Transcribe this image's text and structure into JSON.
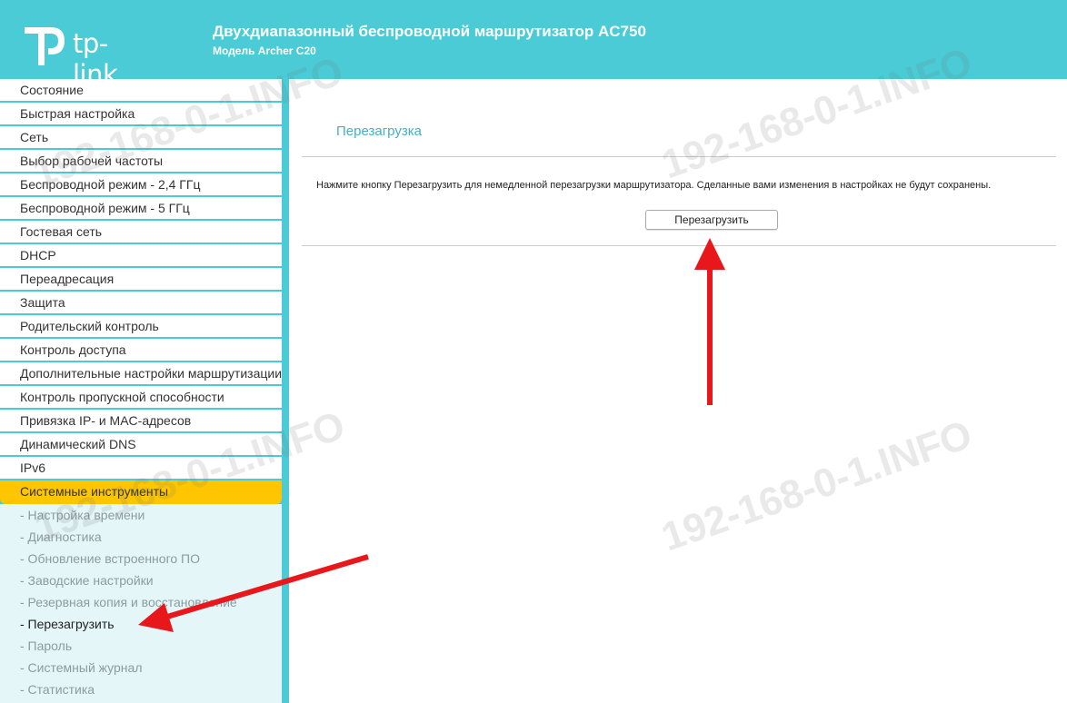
{
  "header": {
    "logo_text": "tp-link",
    "product_title": "Двухдиапазонный беспроводной маршрутизатор AC750",
    "product_model": "Модель Archer C20"
  },
  "sidebar": {
    "items": [
      {
        "label": "Состояние"
      },
      {
        "label": "Быстрая настройка"
      },
      {
        "label": "Сеть"
      },
      {
        "label": "Выбор рабочей частоты"
      },
      {
        "label": "Беспроводной режим - 2,4 ГГц"
      },
      {
        "label": "Беспроводной режим - 5 ГГц"
      },
      {
        "label": "Гостевая сеть"
      },
      {
        "label": "DHCP"
      },
      {
        "label": "Переадресация"
      },
      {
        "label": "Защита"
      },
      {
        "label": "Родительский контроль"
      },
      {
        "label": "Контроль доступа"
      },
      {
        "label": "Дополнительные настройки маршрутизации"
      },
      {
        "label": "Контроль пропускной способности"
      },
      {
        "label": "Привязка IP- и MAC-адресов"
      },
      {
        "label": "Динамический DNS"
      },
      {
        "label": "IPv6"
      },
      {
        "label": "Системные инструменты"
      }
    ],
    "subitems": [
      {
        "label": "- Настройка времени"
      },
      {
        "label": "- Диагностика"
      },
      {
        "label": "- Обновление встроенного ПО"
      },
      {
        "label": "- Заводские настройки"
      },
      {
        "label": "- Резервная копия и восстановление"
      },
      {
        "label": "- Перезагрузить"
      },
      {
        "label": "- Пароль"
      },
      {
        "label": "- Системный журнал"
      },
      {
        "label": "- Статистика"
      }
    ]
  },
  "main": {
    "title": "Перезагрузка",
    "description": "Нажмите кнопку Перезагрузить для немедленной перезагрузки маршрутизатора. Сделанные вами изменения в настройках не будут сохранены.",
    "reboot_button": "Перезагрузить"
  },
  "watermark": "192-168-0-1.INFO",
  "colors": {
    "brand": "#4acbd6",
    "active_menu": "#ffc600",
    "submenu_bg": "#e4f6f8",
    "title_color": "#4aaec2",
    "annotation_arrow": "#e8171b"
  }
}
